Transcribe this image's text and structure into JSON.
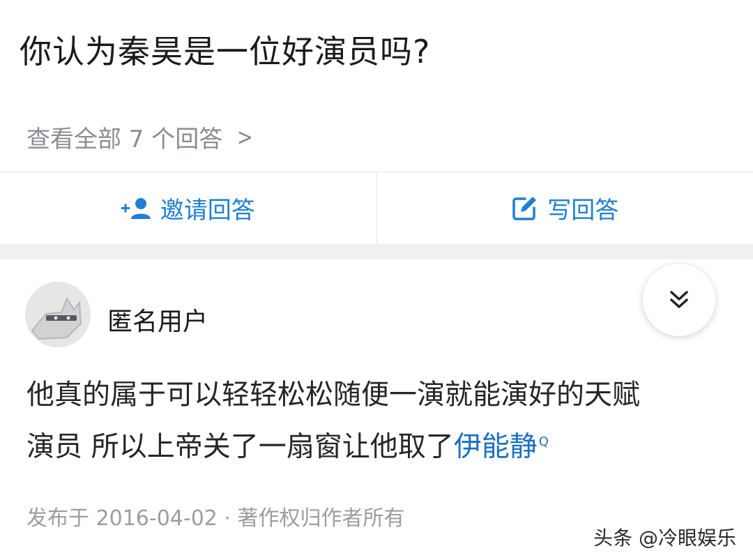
{
  "question": {
    "title": "你认为秦昊是一位好演员吗?",
    "view_all": "查看全部 7 个回答",
    "chevron_glyph": ">"
  },
  "actions": {
    "invite_label": "邀请回答",
    "write_label": "写回答",
    "accent_color": "#1e7fd4",
    "invite_icon": "add-user-icon",
    "write_icon": "edit-icon"
  },
  "answer": {
    "author": "匿名用户",
    "avatar_icon": "anonymous-avatar-icon",
    "collapse_icon": "double-chevron-down-icon",
    "text_line1": "他真的属于可以轻轻松松随便一演就能演好的天赋",
    "text_line2_prefix": "演员 所以上帝关了一扇窗让他取了",
    "text_line2_link": "伊能静",
    "search_mark": "Q",
    "meta": "发布于 2016-04-02 · 著作权归作者所有"
  },
  "watermark": "头条 @冷眼娱乐"
}
